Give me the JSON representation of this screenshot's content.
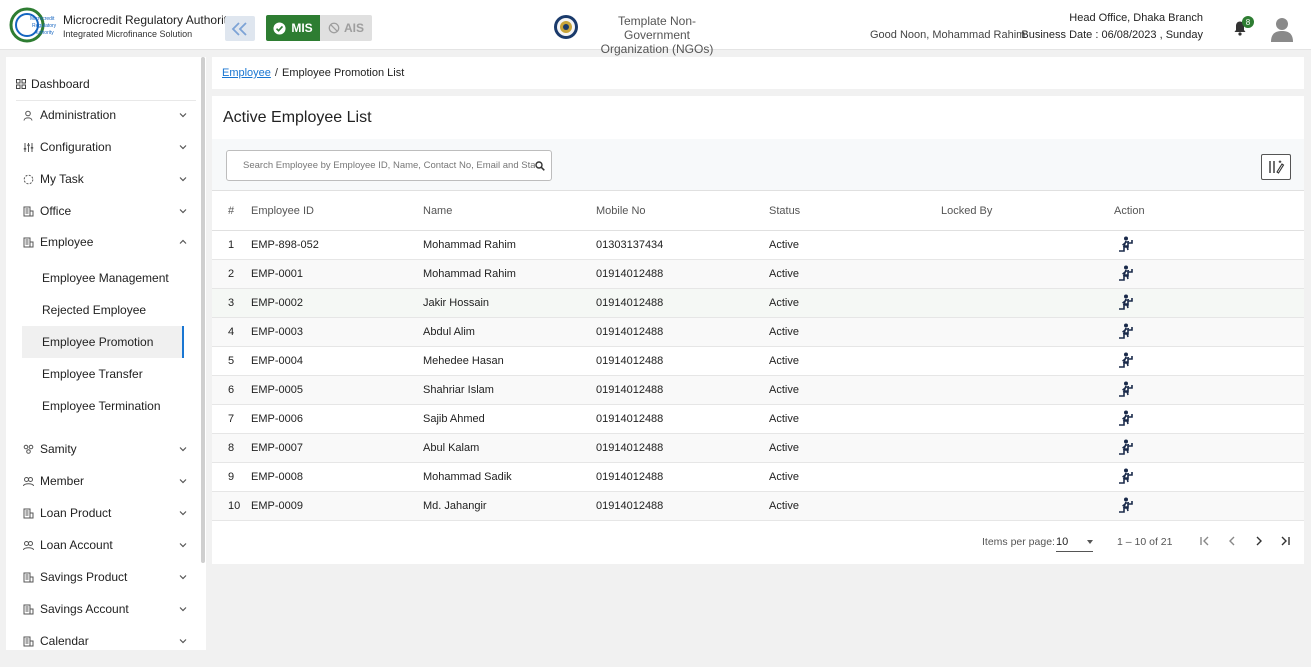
{
  "app": {
    "title": "Microcredit Regulatory Authority",
    "subtitle": "Integrated Microfinance Solution",
    "logo_text": [
      "Microcredit",
      "Regulatory",
      "Authority"
    ]
  },
  "header": {
    "mis_label": "MIS",
    "ais_label": "AIS",
    "org_name_line1": "Template Non-Government",
    "org_name_line2": "Organization (NGOs)",
    "greeting": "Good Noon, Mohammad Rahim",
    "branch": "Head Office, Dhaka Branch",
    "business_date": "Business Date : 06/08/2023 , Sunday",
    "notification_count": "8",
    "accent": "#2e7d32"
  },
  "sidebar": {
    "dashboard": "Dashboard",
    "items_top": [
      {
        "label": "Administration",
        "icon": "admin-icon"
      },
      {
        "label": "Configuration",
        "icon": "sliders-icon"
      },
      {
        "label": "My Task",
        "icon": "spinner-icon"
      },
      {
        "label": "Office",
        "icon": "office-icon"
      },
      {
        "label": "Employee",
        "icon": "employee-icon",
        "expanded": true
      }
    ],
    "employee_sub": [
      {
        "label": "Employee Management"
      },
      {
        "label": "Rejected Employee"
      },
      {
        "label": "Employee Promotion",
        "active": true
      },
      {
        "label": "Employee Transfer"
      },
      {
        "label": "Employee Termination"
      }
    ],
    "items_bottom": [
      {
        "label": "Samity",
        "icon": "samity-icon"
      },
      {
        "label": "Member",
        "icon": "member-icon"
      },
      {
        "label": "Loan Product",
        "icon": "loan-product-icon"
      },
      {
        "label": "Loan Account",
        "icon": "loan-account-icon"
      },
      {
        "label": "Savings Product",
        "icon": "savings-product-icon"
      },
      {
        "label": "Savings Account",
        "icon": "savings-account-icon"
      },
      {
        "label": "Calendar",
        "icon": "calendar-icon"
      }
    ]
  },
  "breadcrumb": {
    "link": "Employee",
    "sep": "/",
    "current": "Employee Promotion List"
  },
  "page": {
    "title": "Active Employee List",
    "search_placeholder": "Search Employee by Employee ID, Name, Contact No, Email and Status"
  },
  "table": {
    "headers": {
      "idx": "#",
      "employee_id": "Employee ID",
      "name": "Name",
      "mobile": "Mobile No",
      "status": "Status",
      "locked_by": "Locked By",
      "action": "Action"
    },
    "rows": [
      {
        "idx": "1",
        "employee_id": "EMP-898-052",
        "name": "Mohammad Rahim",
        "mobile": "01303137434",
        "status": "Active",
        "locked_by": ""
      },
      {
        "idx": "2",
        "employee_id": "EMP-0001",
        "name": "Mohammad Rahim",
        "mobile": "01914012488",
        "status": "Active",
        "locked_by": ""
      },
      {
        "idx": "3",
        "employee_id": "EMP-0002",
        "name": "Jakir Hossain",
        "mobile": "01914012488",
        "status": "Active",
        "locked_by": ""
      },
      {
        "idx": "4",
        "employee_id": "EMP-0003",
        "name": "Abdul Alim",
        "mobile": "01914012488",
        "status": "Active",
        "locked_by": ""
      },
      {
        "idx": "5",
        "employee_id": "EMP-0004",
        "name": "Mehedee Hasan",
        "mobile": "01914012488",
        "status": "Active",
        "locked_by": ""
      },
      {
        "idx": "6",
        "employee_id": "EMP-0005",
        "name": "Shahriar Islam",
        "mobile": "01914012488",
        "status": "Active",
        "locked_by": ""
      },
      {
        "idx": "7",
        "employee_id": "EMP-0006",
        "name": "Sajib Ahmed",
        "mobile": "01914012488",
        "status": "Active",
        "locked_by": ""
      },
      {
        "idx": "8",
        "employee_id": "EMP-0007",
        "name": "Abul Kalam",
        "mobile": "01914012488",
        "status": "Active",
        "locked_by": ""
      },
      {
        "idx": "9",
        "employee_id": "EMP-0008",
        "name": "Mohammad Sadik",
        "mobile": "01914012488",
        "status": "Active",
        "locked_by": ""
      },
      {
        "idx": "10",
        "employee_id": "EMP-0009",
        "name": "Md. Jahangir",
        "mobile": "01914012488",
        "status": "Active",
        "locked_by": ""
      }
    ]
  },
  "paginator": {
    "items_per_page_label": "Items per page:",
    "items_per_page": "10",
    "range": "1 – 10 of 21"
  }
}
